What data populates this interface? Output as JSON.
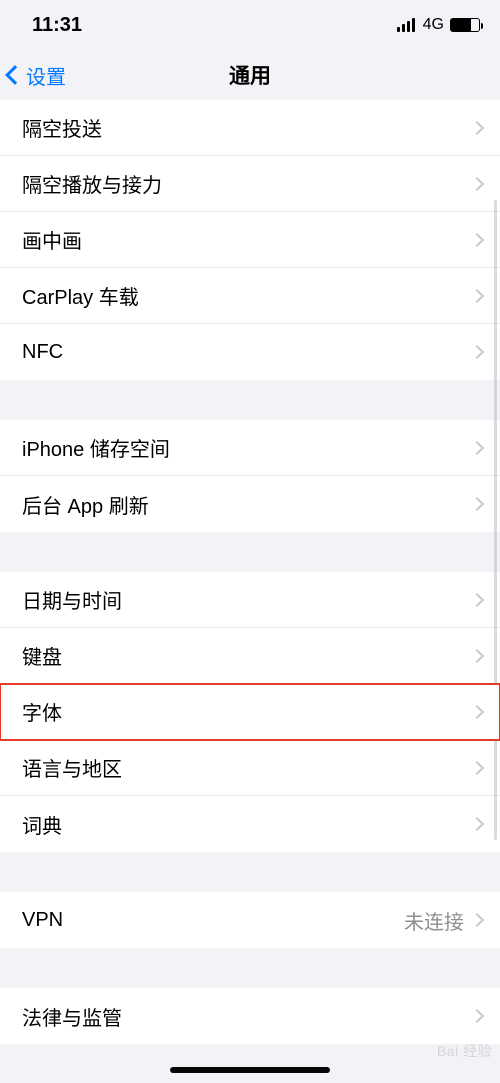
{
  "status": {
    "time": "11:31",
    "network": "4G"
  },
  "nav": {
    "back_label": "设置",
    "title": "通用"
  },
  "sections": [
    {
      "items": [
        {
          "label": "隔空投送"
        },
        {
          "label": "隔空播放与接力"
        },
        {
          "label": "画中画"
        },
        {
          "label": "CarPlay 车载"
        },
        {
          "label": "NFC"
        }
      ]
    },
    {
      "items": [
        {
          "label": "iPhone 储存空间"
        },
        {
          "label": "后台 App 刷新"
        }
      ]
    },
    {
      "items": [
        {
          "label": "日期与时间"
        },
        {
          "label": "键盘"
        },
        {
          "label": "字体",
          "highlighted": true
        },
        {
          "label": "语言与地区"
        },
        {
          "label": "词典"
        }
      ]
    },
    {
      "items": [
        {
          "label": "VPN",
          "detail": "未连接"
        }
      ]
    },
    {
      "items": [
        {
          "label": "法律与监管"
        }
      ]
    }
  ],
  "watermark": "Bai 经验"
}
